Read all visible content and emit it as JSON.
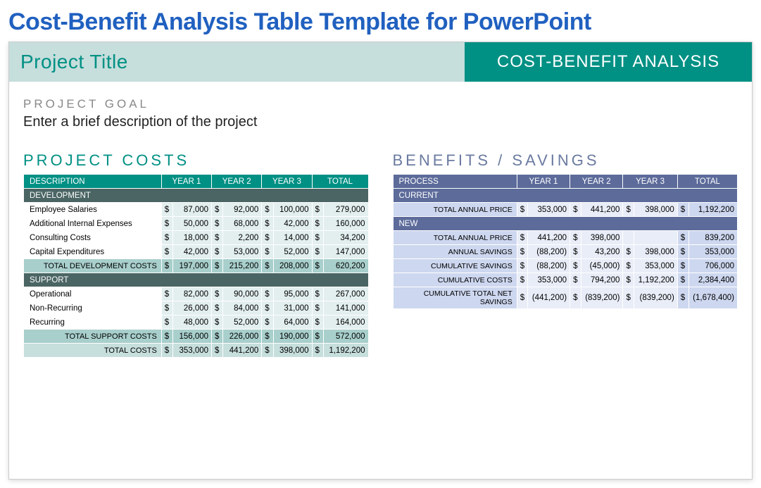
{
  "pageTitle": "Cost-Benefit Analysis Table Template for PowerPoint",
  "banner": {
    "left": "Project Title",
    "right": "COST-BENEFIT ANALYSIS"
  },
  "goal": {
    "label": "PROJECT GOAL",
    "text": "Enter a brief description of the project"
  },
  "costs": {
    "title": "PROJECT COSTS",
    "headers": [
      "DESCRIPTION",
      "YEAR 1",
      "YEAR 2",
      "YEAR 3",
      "TOTAL"
    ],
    "sections": [
      {
        "name": "DEVELOPMENT",
        "rows": [
          {
            "desc": "Employee Salaries",
            "y1": "87,000",
            "y2": "92,000",
            "y3": "100,000",
            "tot": "279,000"
          },
          {
            "desc": "Additional Internal Expenses",
            "y1": "50,000",
            "y2": "68,000",
            "y3": "42,000",
            "tot": "160,000"
          },
          {
            "desc": "Consulting Costs",
            "y1": "18,000",
            "y2": "2,200",
            "y3": "14,000",
            "tot": "34,200"
          },
          {
            "desc": "Capital Expenditures",
            "y1": "42,000",
            "y2": "53,000",
            "y3": "52,000",
            "tot": "147,000"
          }
        ],
        "subtotal": {
          "desc": "TOTAL DEVELOPMENT COSTS",
          "y1": "197,000",
          "y2": "215,200",
          "y3": "208,000",
          "tot": "620,200"
        }
      },
      {
        "name": "SUPPORT",
        "rows": [
          {
            "desc": "Operational",
            "y1": "82,000",
            "y2": "90,000",
            "y3": "95,000",
            "tot": "267,000"
          },
          {
            "desc": "Non-Recurring",
            "y1": "26,000",
            "y2": "84,000",
            "y3": "31,000",
            "tot": "141,000"
          },
          {
            "desc": "Recurring",
            "y1": "48,000",
            "y2": "52,000",
            "y3": "64,000",
            "tot": "164,000"
          }
        ],
        "subtotal": {
          "desc": "TOTAL SUPPORT COSTS",
          "y1": "156,000",
          "y2": "226,000",
          "y3": "190,000",
          "tot": "572,000"
        }
      }
    ],
    "grand": {
      "desc": "TOTAL COSTS",
      "y1": "353,000",
      "y2": "441,200",
      "y3": "398,000",
      "tot": "1,192,200"
    }
  },
  "benefits": {
    "title": "BENEFITS / SAVINGS",
    "headers": [
      "PROCESS",
      "YEAR 1",
      "YEAR 2",
      "YEAR 3",
      "TOTAL"
    ],
    "current": {
      "name": "CURRENT",
      "row": {
        "desc": "TOTAL ANNUAL PRICE",
        "y1": "353,000",
        "y2": "441,200",
        "y3": "398,000",
        "tot": "1,192,200"
      }
    },
    "newsec": {
      "name": "NEW",
      "rows": [
        {
          "desc": "TOTAL ANNUAL PRICE",
          "y1": "441,200",
          "y2": "398,000",
          "y3": "",
          "tot": "839,200"
        },
        {
          "desc": "ANNUAL SAVINGS",
          "y1": "(88,200)",
          "y2": "43,200",
          "y3": "398,000",
          "tot": "353,000"
        },
        {
          "desc": "CUMULATIVE SAVINGS",
          "y1": "(88,200)",
          "y2": "(45,000)",
          "y3": "353,000",
          "tot": "706,000"
        },
        {
          "desc": "CUMULATIVE COSTS",
          "y1": "353,000",
          "y2": "794,200",
          "y3": "1,192,200",
          "tot": "2,384,400",
          "nosym3": true
        },
        {
          "desc": "CUMULATIVE TOTAL NET SAVINGS",
          "y1": "(441,200)",
          "y2": "(839,200)",
          "y3": "(839,200)",
          "tot": "(1,678,400)"
        }
      ]
    }
  }
}
